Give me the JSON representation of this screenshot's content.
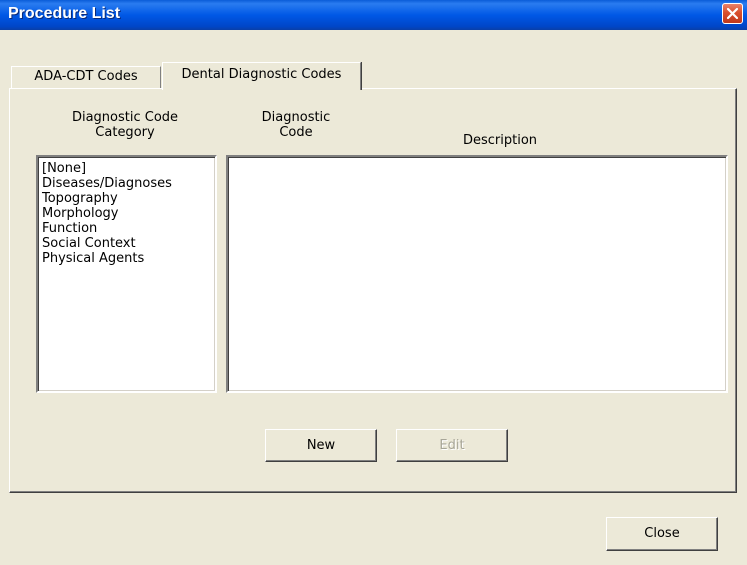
{
  "window": {
    "title": "Procedure List",
    "close_icon": "close-x-icon"
  },
  "tabs": [
    {
      "label": "ADA-CDT Codes",
      "active": false
    },
    {
      "label": "Dental Diagnostic Codes",
      "active": true
    }
  ],
  "category_panel": {
    "header_line1": "Diagnostic Code",
    "header_line2": "Category",
    "items": [
      "[None]",
      "Diseases/Diagnoses",
      "Topography",
      "Morphology",
      "Function",
      "Social Context",
      "Physical Agents"
    ]
  },
  "code_panel": {
    "code_header_line1": "Diagnostic",
    "code_header_line2": "Code",
    "description_header": "Description",
    "rows": []
  },
  "buttons": {
    "new_label": "New",
    "edit_label": "Edit",
    "edit_enabled": false,
    "close_label": "Close"
  },
  "colors": {
    "titlebar": "#0058e6",
    "window_bg": "#ece9d8",
    "close_button": "#d9502e"
  }
}
